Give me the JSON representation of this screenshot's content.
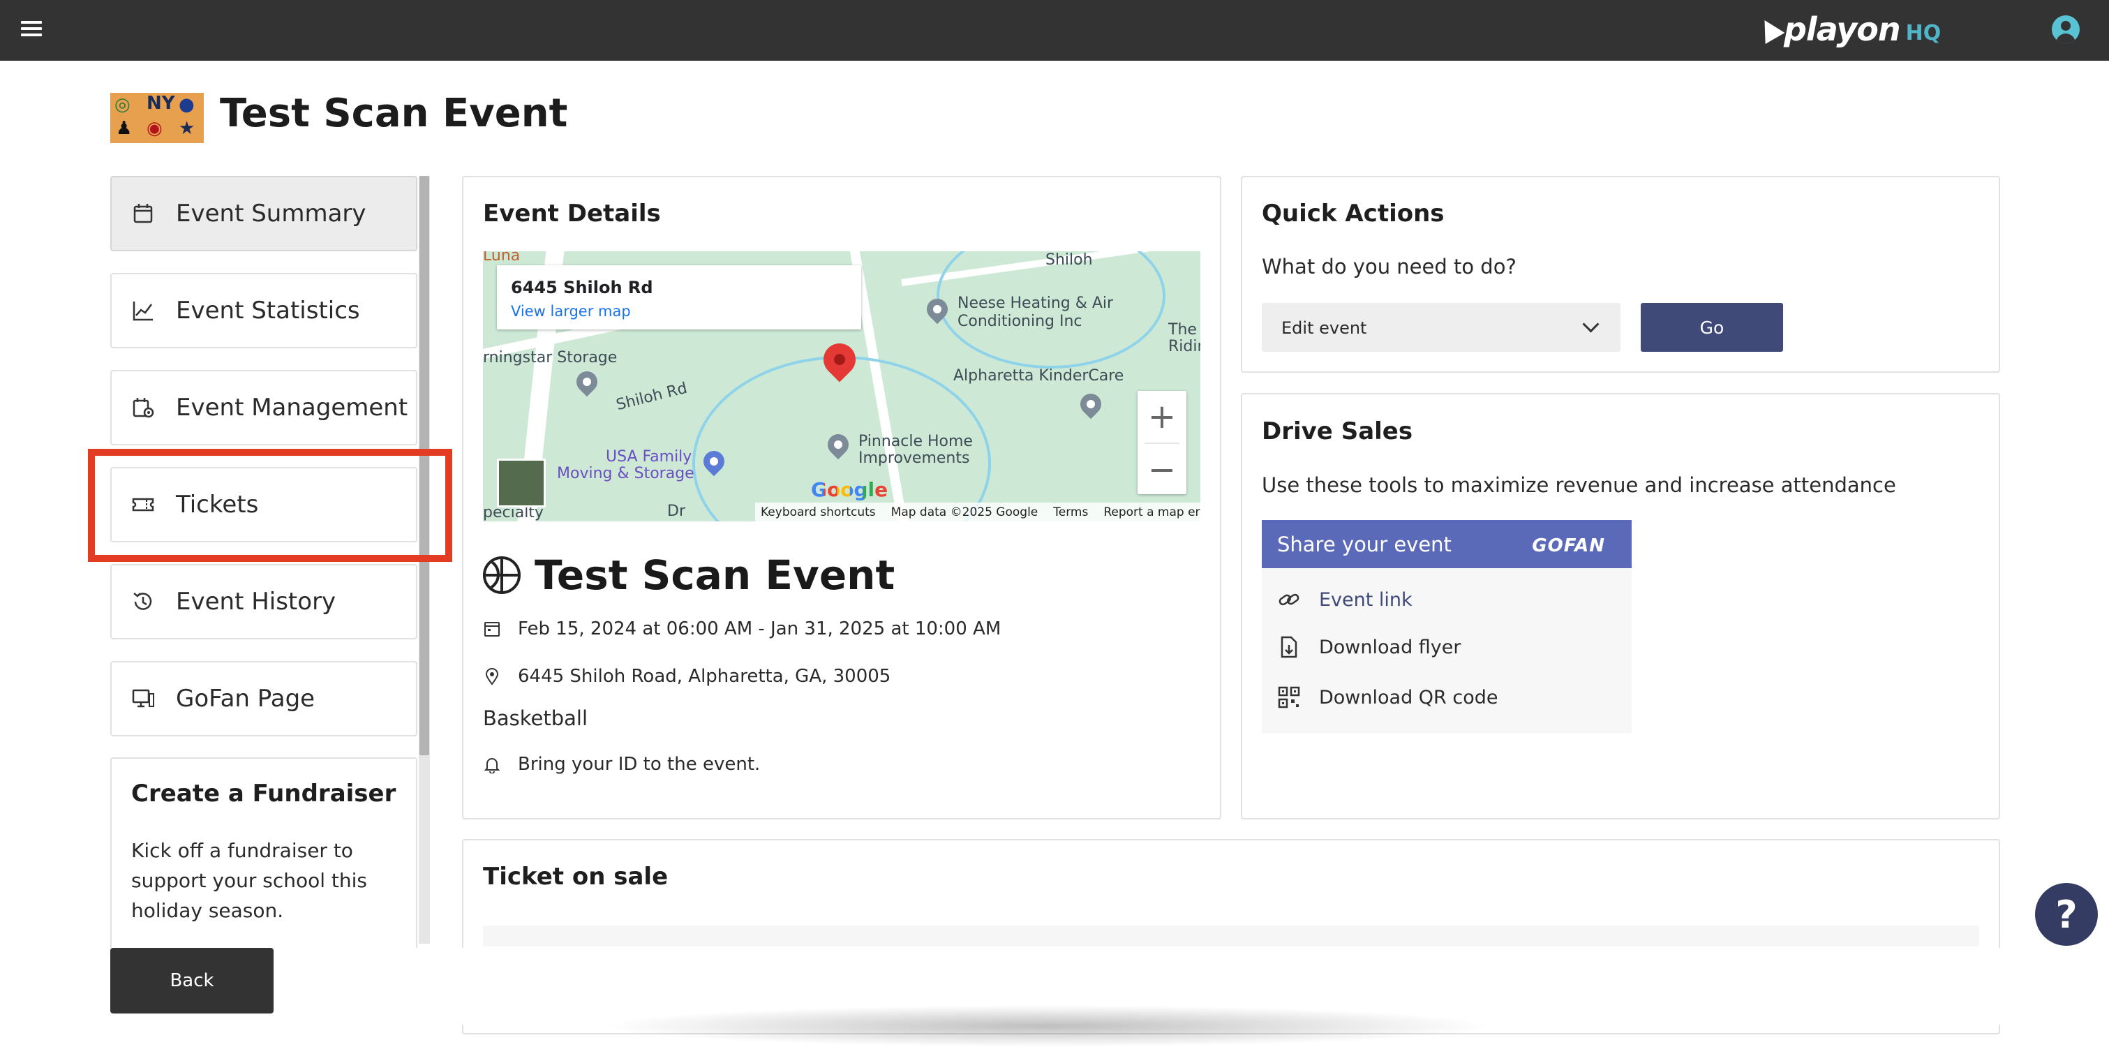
{
  "colors": {
    "topbar": "#333333",
    "accent": "#3f4a78",
    "share_header": "#5b6ab8",
    "highlight": "#e23c23",
    "help_button": "#343c63"
  },
  "brand": {
    "name": "playon",
    "suffix": "HQ"
  },
  "page": {
    "title": "Test Scan Event"
  },
  "sidebar": {
    "items": [
      {
        "label": "Event Summary",
        "icon": "calendar-icon",
        "active": true
      },
      {
        "label": "Event Statistics",
        "icon": "chart-line-icon",
        "active": false
      },
      {
        "label": "Event Management",
        "icon": "calendar-gear-icon",
        "active": false
      },
      {
        "label": "Tickets",
        "icon": "ticket-icon",
        "active": false
      },
      {
        "label": "Event History",
        "icon": "history-icon",
        "active": false
      },
      {
        "label": "GoFan Page",
        "icon": "monitor-icon",
        "active": false
      }
    ],
    "fundraiser": {
      "title": "Create a Fundraiser",
      "text": "Kick off a fundraiser to support your school this holiday season."
    },
    "back_label": "Back"
  },
  "event_details": {
    "title": "Event Details",
    "map": {
      "info_address": "6445 Shiloh Rd",
      "info_link": "View larger map",
      "labels": [
        "Luna",
        "Shiloh",
        "Neese Heating & Air",
        "Conditioning Inc",
        "The",
        "Ridin",
        "rningstar Storage",
        "Shiloh Rd",
        "Alpharetta KinderCare",
        "USA Family",
        "Moving & Storage",
        "Pinnacle Home",
        "Improvements",
        "pecialty",
        "Dr"
      ],
      "zoom_in": "+",
      "zoom_out": "−",
      "google": "Google",
      "footer": [
        "Keyboard shortcuts",
        "Map data ©2025 Google",
        "Terms",
        "Report a map error"
      ]
    },
    "event_name": "Test Scan Event",
    "datetime": "Feb 15, 2024 at 06:00 AM - Jan 31, 2025 at 10:00 AM",
    "address": "6445 Shiloh Road, Alpharetta, GA, 30005",
    "sport": "Basketball",
    "note": "Bring your ID to the event."
  },
  "quick_actions": {
    "title": "Quick Actions",
    "subtitle": "What do you need to do?",
    "select_value": "Edit event",
    "go_label": "Go"
  },
  "drive_sales": {
    "title": "Drive Sales",
    "subtitle": "Use these tools to maximize revenue and increase attendance",
    "share_header": "Share your event",
    "share_logo": "GOFAN",
    "items": [
      {
        "label": "Event link",
        "icon": "link-icon"
      },
      {
        "label": "Download flyer",
        "icon": "file-download-icon"
      },
      {
        "label": "Download QR code",
        "icon": "qr-code-icon"
      }
    ]
  },
  "ticket_on_sale": {
    "title": "Ticket on sale"
  },
  "help": {
    "label": "?"
  }
}
